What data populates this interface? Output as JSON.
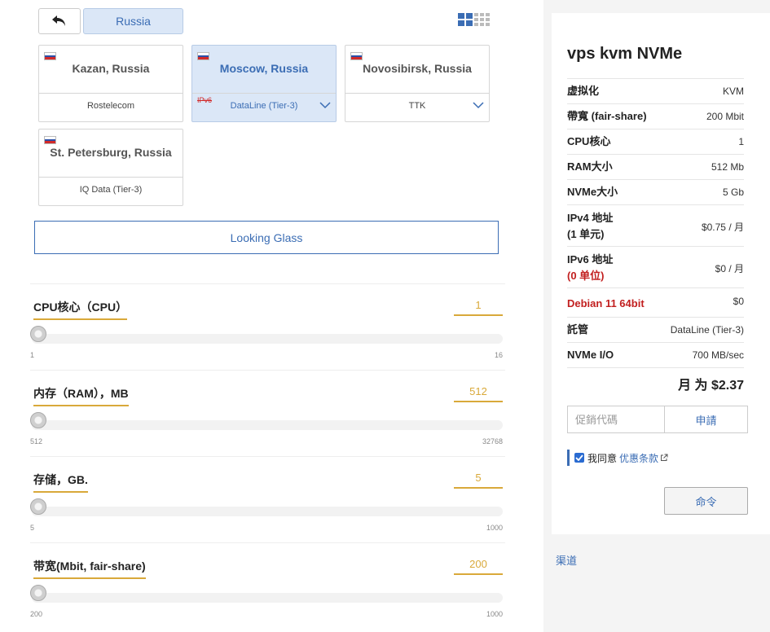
{
  "nav": {
    "country": "Russia"
  },
  "locations": [
    {
      "city": "Kazan, Russia",
      "datacenter": "Rostelecom",
      "selected": false,
      "expandable": false,
      "ipv6_note": ""
    },
    {
      "city": "Moscow, Russia",
      "datacenter": "DataLine (Tier-3)",
      "selected": true,
      "expandable": true,
      "ipv6_note": "IPv6"
    },
    {
      "city": "Novosibirsk, Russia",
      "datacenter": "TTK",
      "selected": false,
      "expandable": true,
      "ipv6_note": ""
    },
    {
      "city": "St. Petersburg, Russia",
      "datacenter": "IQ Data (Tier-3)",
      "selected": false,
      "expandable": false,
      "ipv6_note": ""
    }
  ],
  "looking_glass": "Looking Glass",
  "sliders": [
    {
      "label": "CPU核心（CPU）",
      "value": 1,
      "min": 1,
      "max": 16
    },
    {
      "label": "内存（RAM），MB",
      "value": 512,
      "min": 512,
      "max": 32768
    },
    {
      "label": "存储，GB.",
      "value": 5,
      "min": 5,
      "max": 1000
    },
    {
      "label": "带宽(Mbit, fair-share)",
      "value": 200,
      "min": 200,
      "max": 1000
    }
  ],
  "summary": {
    "title": "vps kvm NVMe",
    "specs": [
      {
        "key": "虚拟化",
        "key_sub": "",
        "value": "KVM"
      },
      {
        "key": "帶寬 (fair-share)",
        "key_sub": "",
        "value": "200 Mbit"
      },
      {
        "key": "CPU核心",
        "key_sub": "",
        "value": "1"
      },
      {
        "key": "RAM大小",
        "key_sub": "",
        "value": "512 Mb"
      },
      {
        "key": "NVMe大小",
        "key_sub": "",
        "value": "5 Gb"
      },
      {
        "key": "IPv4 地址",
        "key_sub": "(1 单元)",
        "value": "$0.75 / 月"
      },
      {
        "key": "IPv6 地址",
        "key_sub": "(0 单位)",
        "value": "$0 / 月"
      },
      {
        "key": "Debian 11 64bit",
        "key_sub": "",
        "value": "$0"
      },
      {
        "key": "託管",
        "key_sub": "",
        "value": "DataLine (Tier-3)"
      },
      {
        "key": "NVMe I/O",
        "key_sub": "",
        "value": "700 MB/sec"
      }
    ],
    "total": "月 为 $2.37",
    "promo_placeholder": "促銷代碼",
    "apply_label": "申請",
    "agree_label": "我同意",
    "terms_label": "优惠条款",
    "order_label": "命令"
  },
  "channel_link": "渠道",
  "colors": {
    "accent": "#3b6db4",
    "slider_accent": "#d9a93a",
    "warning": "#c22020",
    "selected_bg": "#dbe7f7"
  }
}
